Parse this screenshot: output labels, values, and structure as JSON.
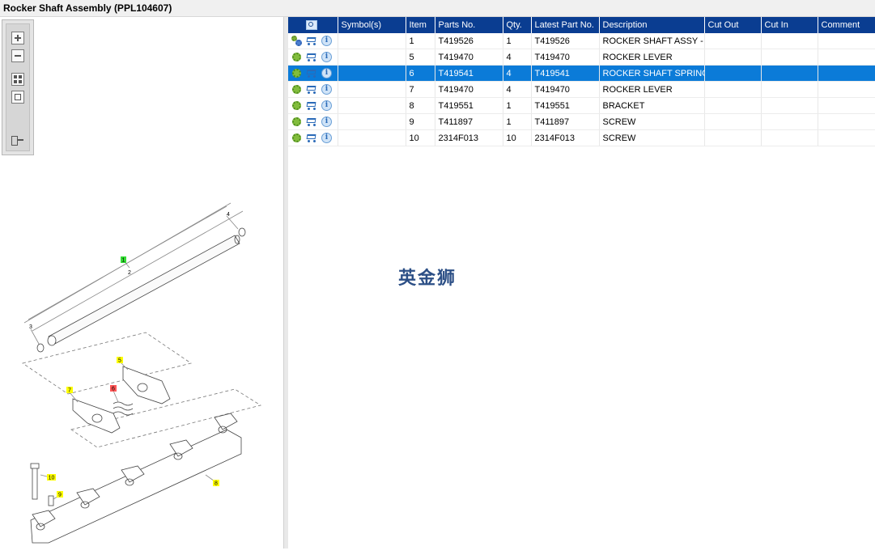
{
  "window": {
    "title": "Rocker Shaft Assembly (PPL104607)"
  },
  "toolbar": {
    "buttons": [
      "zoom-in",
      "zoom-out",
      "fit-all",
      "fit-window",
      "export"
    ]
  },
  "diagram": {
    "callouts": [
      {
        "label": "1",
        "color": "#33dd33"
      },
      {
        "label": "2",
        "color": "none"
      },
      {
        "label": "3",
        "color": "none"
      },
      {
        "label": "4",
        "color": "none"
      },
      {
        "label": "5",
        "color": "#ffff00"
      },
      {
        "label": "6",
        "color": "#ff5555"
      },
      {
        "label": "7",
        "color": "#ffff00"
      },
      {
        "label": "8",
        "color": "#ffff00"
      },
      {
        "label": "9",
        "color": "#ffff00"
      },
      {
        "label": "10",
        "color": "#ffff00"
      }
    ]
  },
  "grid": {
    "columns": [
      "",
      "Symbol(s)",
      "Item",
      "Parts No.",
      "Qty.",
      "Latest Part No.",
      "Description",
      "Cut Out",
      "Cut In",
      "Comment"
    ],
    "rows": [
      {
        "item": "1",
        "part_no": "T419526",
        "qty": "1",
        "latest": "T419526",
        "description": "ROCKER SHAFT ASSY - M",
        "first_icon": "gears-icon"
      },
      {
        "item": "5",
        "part_no": "T419470",
        "qty": "4",
        "latest": "T419470",
        "description": "ROCKER LEVER",
        "first_icon": "gear-icon"
      },
      {
        "item": "6",
        "part_no": "T419541",
        "qty": "4",
        "latest": "T419541",
        "description": "ROCKER SHAFT SPRING",
        "first_icon": "gear-icon"
      },
      {
        "item": "7",
        "part_no": "T419470",
        "qty": "4",
        "latest": "T419470",
        "description": "ROCKER LEVER",
        "first_icon": "gear-icon"
      },
      {
        "item": "8",
        "part_no": "T419551",
        "qty": "1",
        "latest": "T419551",
        "description": "BRACKET",
        "first_icon": "gear-icon"
      },
      {
        "item": "9",
        "part_no": "T411897",
        "qty": "1",
        "latest": "T411897",
        "description": "SCREW",
        "first_icon": "gear-icon"
      },
      {
        "item": "10",
        "part_no": "2314F013",
        "qty": "10",
        "latest": "2314F013",
        "description": "SCREW",
        "first_icon": "gear-icon"
      }
    ],
    "selected_row": 2
  },
  "watermark": "英金狮",
  "colors": {
    "header": "#0a3d91",
    "selection": "#0b7bd8"
  }
}
